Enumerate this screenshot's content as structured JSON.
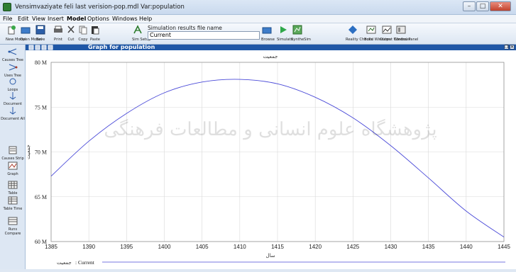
{
  "window": {
    "title": "Vensimvaziyate feli last verision-pop.mdl Var:population",
    "minimize": "–",
    "maximize": "□",
    "close": "✕"
  },
  "menu": [
    "File",
    "Edit",
    "View",
    "Insert",
    "Model",
    "Options",
    "Windows",
    "Help"
  ],
  "toolbar": {
    "buttons": [
      {
        "label": "New Model",
        "icon": "new-model-icon"
      },
      {
        "label": "Open Model",
        "icon": "open-model-icon"
      },
      {
        "label": "Save",
        "icon": "save-icon"
      },
      {
        "label": "Print",
        "icon": "print-icon"
      },
      {
        "label": "Cut",
        "icon": "cut-icon"
      },
      {
        "label": "Copy",
        "icon": "copy-icon"
      },
      {
        "label": "Paste",
        "icon": "paste-icon"
      },
      {
        "label": "Sim Setup",
        "icon": "sim-setup-icon"
      }
    ],
    "sim_results_label": "Simulation results file name",
    "sim_results_value": "Current",
    "right_buttons": [
      {
        "label": "Browse",
        "icon": "browse-icon"
      },
      {
        "label": "Simulate",
        "icon": "simulate-icon"
      },
      {
        "label": "SyntheSim",
        "icon": "synthesim-icon"
      },
      {
        "label": "Reality Checks",
        "icon": "reality-checks-icon"
      },
      {
        "label": "Build Windows",
        "icon": "build-windows-icon"
      },
      {
        "label": "Output Windows",
        "icon": "output-windows-icon"
      },
      {
        "label": "Control Panel",
        "icon": "control-panel-icon"
      }
    ]
  },
  "sidebar": [
    {
      "label": "Causes Tree"
    },
    {
      "label": "Uses Tree"
    },
    {
      "label": "Loops"
    },
    {
      "label": "Document"
    },
    {
      "label": "Document All"
    },
    {
      "label": "Causes Strip"
    },
    {
      "label": "Graph"
    },
    {
      "label": "Table"
    },
    {
      "label": "Table Time"
    },
    {
      "label": "Runs Compare"
    }
  ],
  "graph_window": {
    "title": "Graph for population",
    "close_btn": "✕",
    "restore_btn": "❐"
  },
  "chart_data": {
    "type": "line",
    "title": "جمعیت",
    "xlabel": "سال",
    "ylabel": "جمعیت",
    "xlim": [
      1385,
      1445
    ],
    "ylim": [
      60,
      80
    ],
    "x_ticks": [
      "1385",
      "1390",
      "1395",
      "1400",
      "1405",
      "1410",
      "1415",
      "1420",
      "1425",
      "1430",
      "1435",
      "1440",
      "1445"
    ],
    "y_ticks": [
      "60 M",
      "65 M",
      "70 M",
      "75 M",
      "80 M"
    ],
    "grid": true,
    "legend": {
      "series_label": "جمعیت",
      "run_label": ": Current"
    },
    "series": [
      {
        "name": "جمعیت : Current",
        "color": "#4a4ad8",
        "x": [
          1385,
          1390,
          1395,
          1400,
          1405,
          1410,
          1415,
          1420,
          1425,
          1430,
          1435,
          1440,
          1445
        ],
        "values": [
          67.3,
          71.2,
          74.3,
          76.6,
          77.8,
          78.1,
          77.6,
          76.1,
          73.8,
          70.7,
          67.1,
          63.4,
          60.5
        ]
      }
    ]
  },
  "watermark_text": "پژوهشگاه علوم انسانی و مطالعات فرهنگی"
}
